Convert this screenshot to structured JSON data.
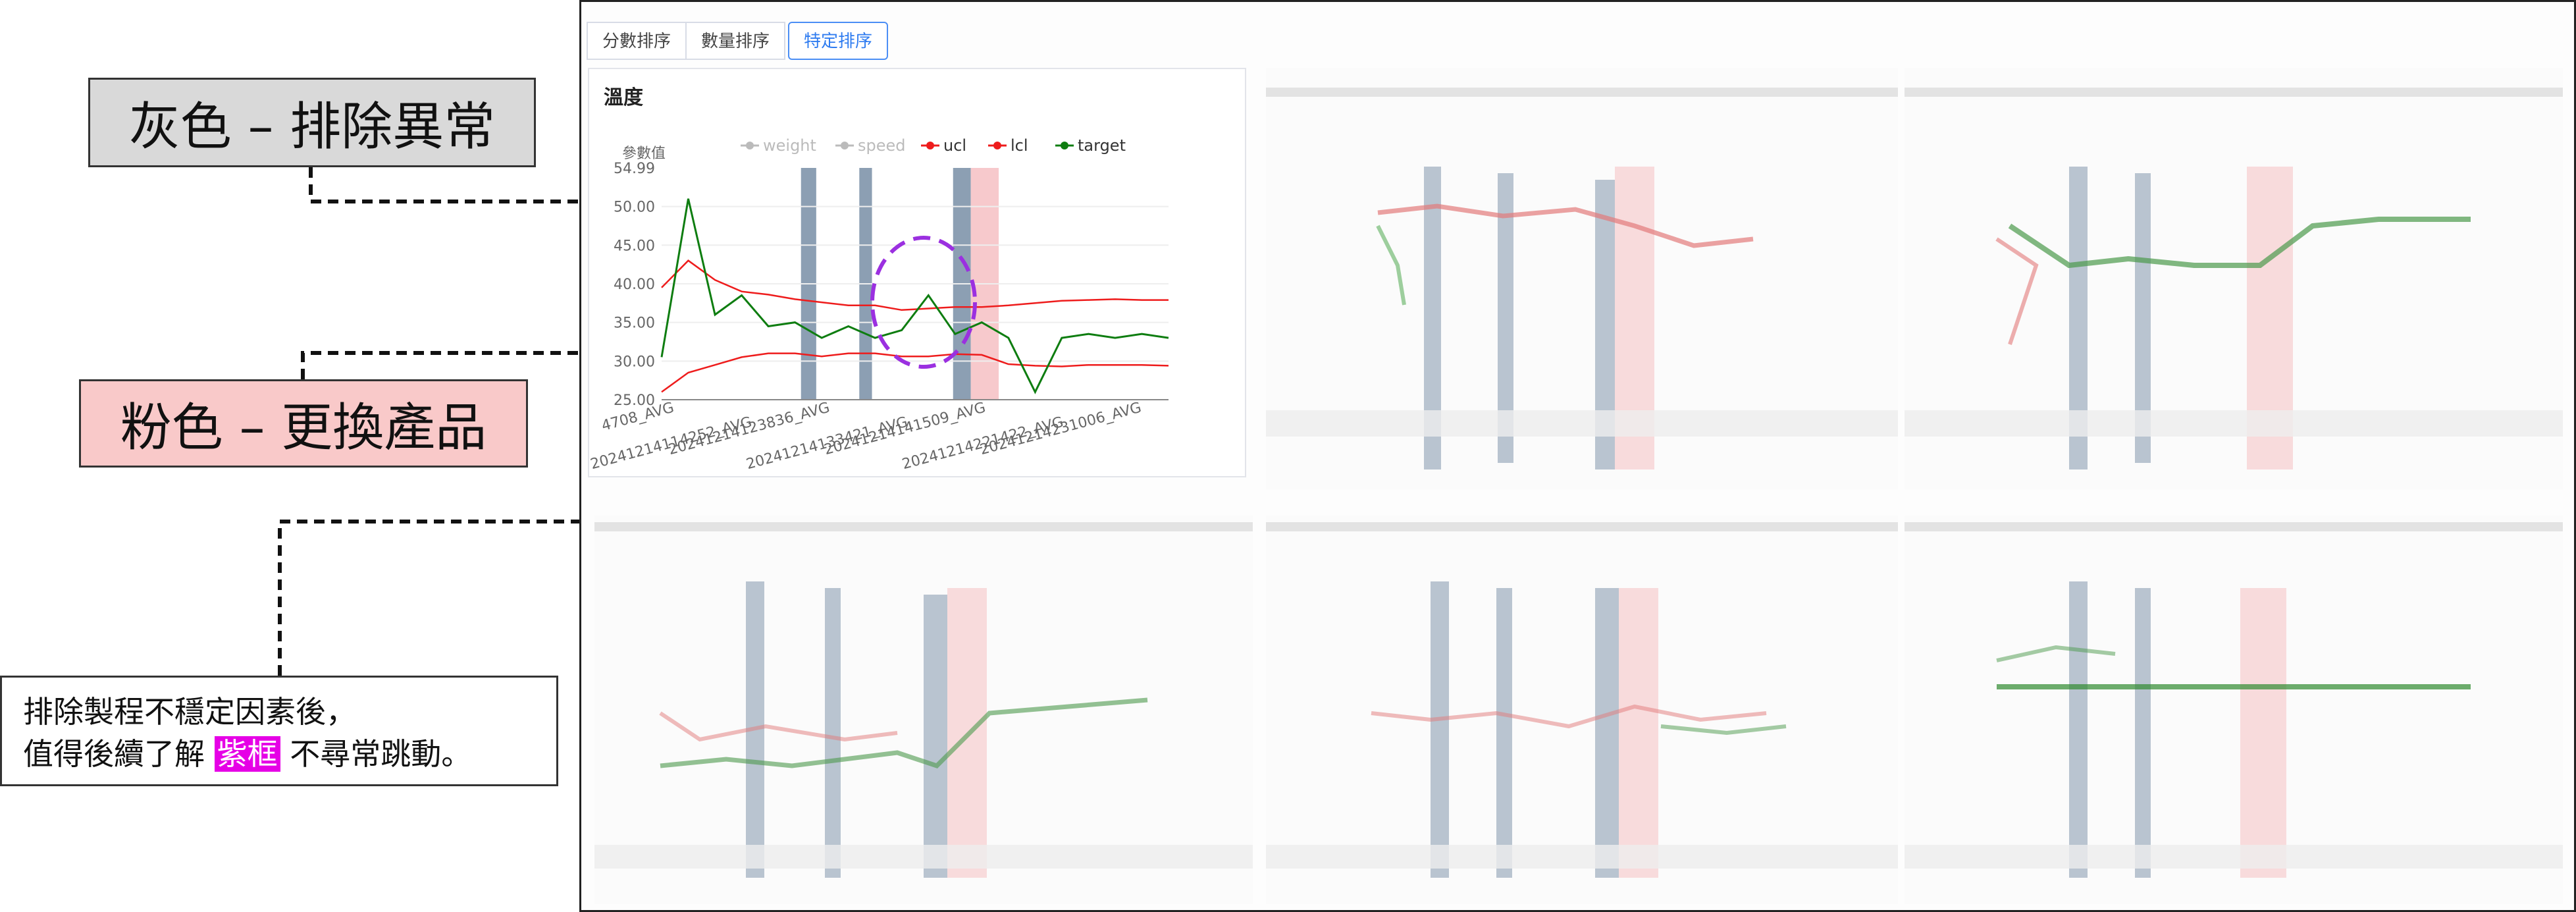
{
  "annotations": {
    "gray_note": "灰色 – 排除異常",
    "pink_note": "粉色 – 更換產品",
    "bottom_note_line1": "排除製程不穩定因素後，",
    "bottom_note_line2_prefix": "值得後續了解",
    "bottom_note_highlight": "紫框",
    "bottom_note_line2_suffix": "不尋常跳動。"
  },
  "tabs": [
    {
      "label": "分數排序",
      "active": false
    },
    {
      "label": "數量排序",
      "active": false
    },
    {
      "label": "特定排序",
      "active": true
    }
  ],
  "card": {
    "title": "溫度"
  },
  "colors": {
    "gray_band": "#8c9fb3",
    "pink_band": "#f7c9cc",
    "ucl": "#ee1c1c",
    "lcl": "#ee1c1c",
    "target": "#0e7d10",
    "legend_disabled": "#bbbbbb",
    "purple_circle": "#9b30e0",
    "tab_active": "#2f7cf0"
  },
  "chart_data": {
    "type": "line",
    "ylabel": "參數值",
    "ymax_label": "54.99",
    "yticks": [
      "50.00",
      "45.00",
      "40.00",
      "35.00",
      "30.00",
      "25.00"
    ],
    "ylim": [
      25,
      54.99
    ],
    "legend": [
      {
        "name": "weight",
        "enabled": false
      },
      {
        "name": "speed",
        "enabled": false
      },
      {
        "name": "ucl",
        "enabled": true
      },
      {
        "name": "lcl",
        "enabled": true
      },
      {
        "name": "target",
        "enabled": true
      }
    ],
    "xticks": [
      "4708_AVG",
      "20241214114252_AVG",
      "20241214123836_AVG",
      "20241214133421_AVG",
      "20241214141509_AVG",
      "20241214221422_AVG",
      "20241214231006_AVG"
    ],
    "series": [
      {
        "name": "ucl",
        "values": [
          39.5,
          43.0,
          40.5,
          39.0,
          38.6,
          38.0,
          37.6,
          37.2,
          37.2,
          36.6,
          36.8,
          37.0,
          37.0,
          37.2,
          37.5,
          37.8,
          37.9,
          38.0,
          37.9,
          37.9
        ]
      },
      {
        "name": "lcl",
        "values": [
          26.0,
          28.5,
          29.5,
          30.5,
          31.0,
          31.0,
          30.6,
          31.0,
          31.0,
          30.6,
          30.6,
          30.9,
          30.8,
          29.6,
          29.4,
          29.3,
          29.5,
          29.5,
          29.5,
          29.4
        ]
      },
      {
        "name": "target",
        "values": [
          30.5,
          51.0,
          36.0,
          38.5,
          34.5,
          35.0,
          33.0,
          34.5,
          33.0,
          34.0,
          38.5,
          33.5,
          35.0,
          33.0,
          26.0,
          33.0,
          33.5,
          33.0,
          33.5,
          33.0
        ]
      }
    ],
    "gray_bands_fraction": [
      [
        0.275,
        0.305
      ],
      [
        0.39,
        0.415
      ],
      [
        0.575,
        0.61
      ]
    ],
    "pink_band_fraction": [
      0.61,
      0.665
    ]
  }
}
